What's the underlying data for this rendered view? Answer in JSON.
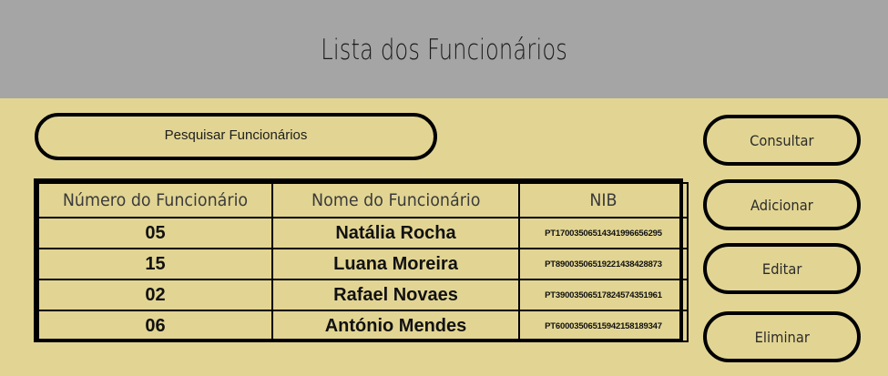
{
  "header": {
    "title": "Lista dos Funcionários"
  },
  "search": {
    "label": "Pesquisar Funcionários"
  },
  "table": {
    "headers": [
      "Número do Funcionário",
      "Nome do Funcionário",
      "NIB"
    ],
    "rows": [
      {
        "numero": "05",
        "nome": "Natália Rocha",
        "nib": "PT17003506514341996656295"
      },
      {
        "numero": "15",
        "nome": "Luana Moreira",
        "nib": "PT89003506519221438428873"
      },
      {
        "numero": "02",
        "nome": "Rafael Novaes",
        "nib": "PT39003506517824574351961"
      },
      {
        "numero": "06",
        "nome": "António Mendes",
        "nib": "PT60003506515942158189347"
      }
    ]
  },
  "actions": {
    "consultar": "Consultar",
    "adicionar": "Adicionar",
    "editar": "Editar",
    "eliminar": "Eliminar"
  },
  "colors": {
    "background": "#e2d593",
    "header": "#a5a5a6",
    "border": "#000000"
  }
}
